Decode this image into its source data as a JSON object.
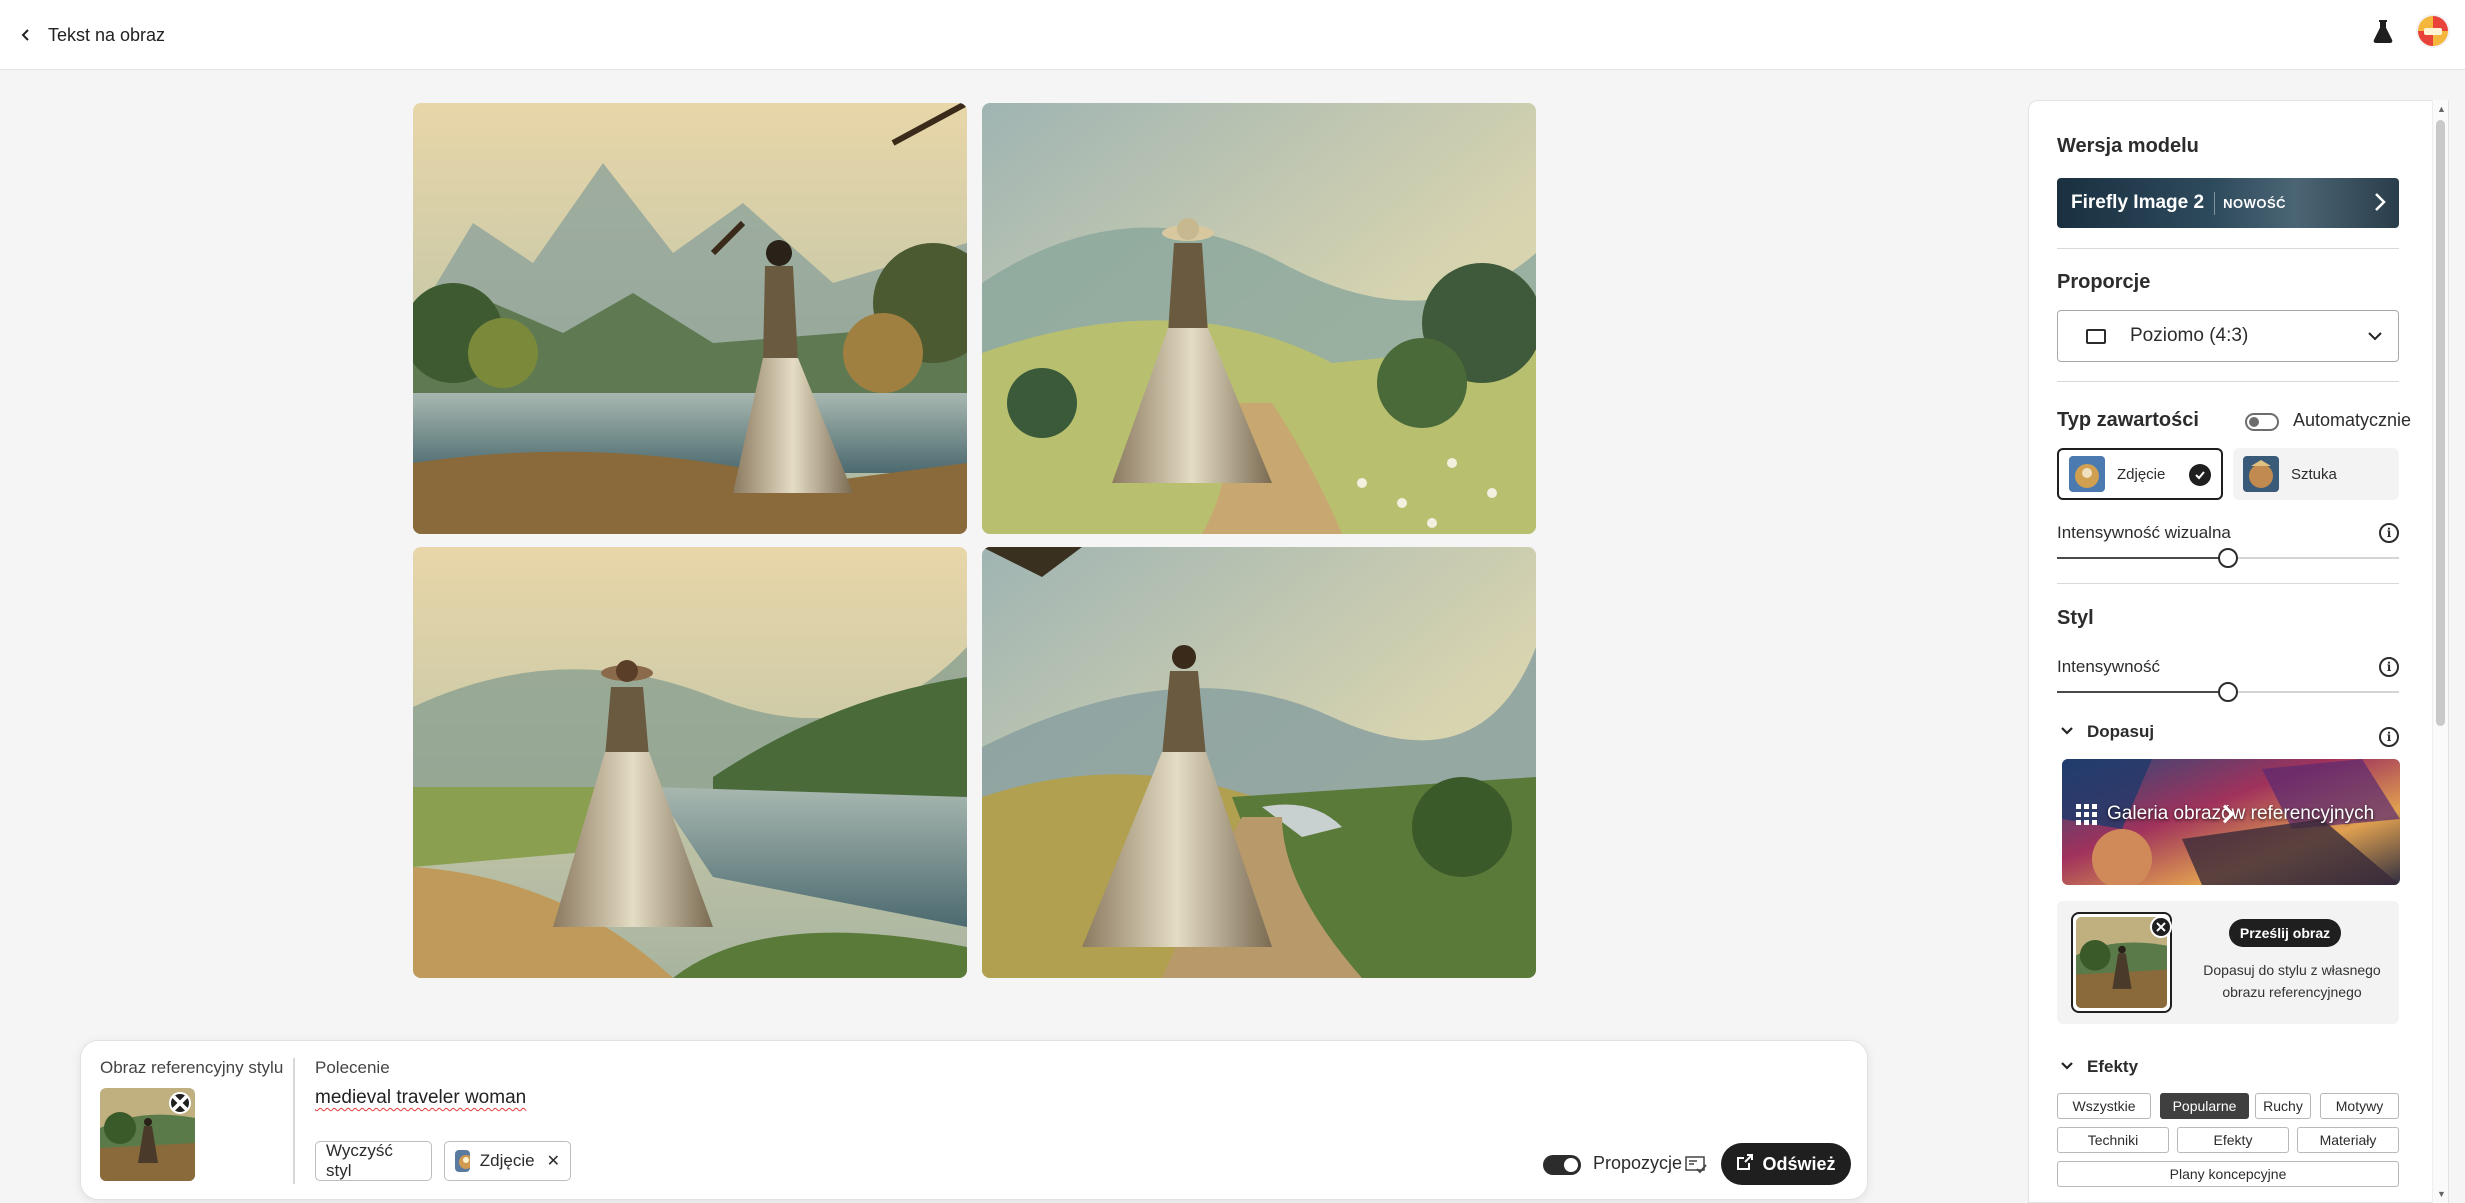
{
  "header": {
    "title": "Tekst na obraz"
  },
  "prompt_bar": {
    "ref_label": "Obraz referencyjny stylu",
    "prompt_label": "Polecenie",
    "prompt_value": "medieval traveler woman",
    "clear_style_label": "Wyczyść styl",
    "content_chip_label": "Zdjęcie",
    "suggestions_label": "Propozycje",
    "suggestions_enabled": true,
    "refresh_label": "Odśwież"
  },
  "panel": {
    "model_section_title": "Wersja modelu",
    "model_name": "Firefly Image 2",
    "model_badge": "NOWOŚĆ",
    "aspect_title": "Proporcje",
    "aspect_value": "Poziomo (4:3)",
    "content_type_title": "Typ zawartości",
    "auto_label": "Automatycznie",
    "auto_enabled": false,
    "content_types": [
      {
        "label": "Zdjęcie",
        "selected": true
      },
      {
        "label": "Sztuka",
        "selected": false
      }
    ],
    "visual_intensity_label": "Intensywność wizualna",
    "visual_intensity_value": 0.5,
    "style_title": "Styl",
    "style_intensity_label": "Intensywność",
    "style_intensity_value": 0.5,
    "match_title": "Dopasuj",
    "gallery_label": "Galeria obrazów referencyjnych",
    "upload_button": "Prześlij obraz",
    "upload_desc": "Dopasuj do stylu z własnego obrazu referencyjnego",
    "effects_title": "Efekty",
    "effects_tabs": [
      "Wszystkie",
      "Popularne",
      "Ruchy",
      "Motywy",
      "Techniki",
      "Efekty",
      "Materiały",
      "Plany koncepcyjne"
    ],
    "effects_active": "Popularne"
  },
  "colors": {
    "accent_dark": "#1f1f1f",
    "panel_bg": "#ffffff",
    "canvas_bg": "#f5f5f5"
  }
}
